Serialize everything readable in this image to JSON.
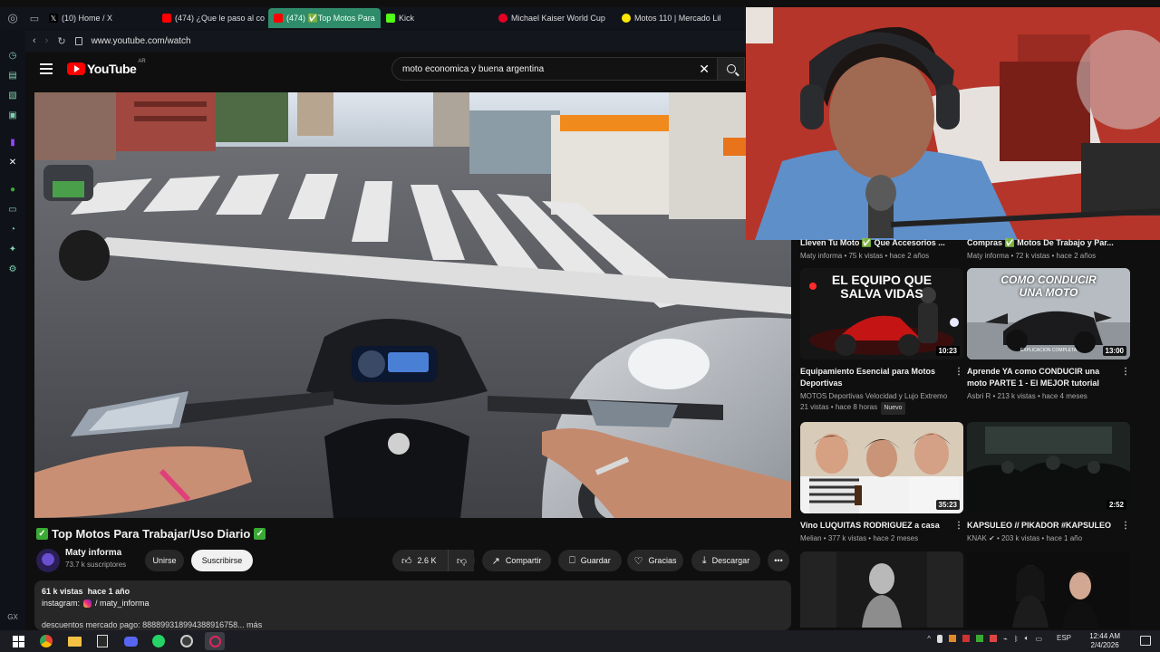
{
  "browser": {
    "logo": "GX",
    "tabs": [
      {
        "label": "(10) Home / X",
        "color": "#ffffff"
      },
      {
        "label": "(474) ¿Que le paso al co",
        "color": "#ff0000"
      },
      {
        "label": "(474) ✅Top Motos Para",
        "color": "#ff0000",
        "active": true
      },
      {
        "label": "Kick",
        "color": "#53fc18"
      },
      {
        "label": "Michael Kaiser World Cup",
        "color": "#e60023"
      },
      {
        "label": "Motos 110 | Mercado Libre",
        "color": "#ffe600"
      }
    ],
    "url": "www.youtube.com/watch",
    "accent": "#2f8c6a"
  },
  "youtube": {
    "logo_text": "YouTube",
    "country_code": "AR",
    "search_value": "moto economica y buena argentina"
  },
  "video": {
    "title": "Top Motos Para Trabajar/Uso Diario",
    "channel": "Maty informa",
    "subscribers": "73.7 k suscriptores",
    "join_label": "Unirse",
    "subscribe_label": "Suscribirse",
    "likes": "2.6 K",
    "share_label": "Compartir",
    "save_label": "Guardar",
    "thanks_label": "Gracias",
    "download_label": "Descargar",
    "views": "61 k vistas",
    "age": "hace 1 año",
    "instagram_prefix": "instagram:",
    "instagram_handle": "/ maty_informa",
    "desc_line3": "descuentos mercado pago: 888899318994388916758...  más"
  },
  "recommendations": {
    "partial_top": [
      {
        "title": "Lleven Tu Moto ✅ Que Accesorios ...",
        "meta": "Maty informa • 75 k vistas • hace 2 años"
      },
      {
        "title": "Compras ✅ Motos De Trabajo y Par...",
        "meta": "Maty informa • 72 k vistas • hace 2 años"
      }
    ],
    "cards": [
      {
        "title": "Equipamiento Esencial para Motos Deportivas",
        "channel": "MOTOS Deportivas Velocidad y Lujo Extremo",
        "meta": "21 vistas • hace 8 horas",
        "badge": "Nuevo",
        "duration": "10:23",
        "thumb_text": "EL EQUIPO QUE SALVA VIDAS"
      },
      {
        "title": "Aprende YA como CONDUCIR una moto PARTE 1 - El MEJOR tutorial",
        "channel": "Asbri R",
        "meta": "213 k vistas • hace 4 meses",
        "duration": "13:00",
        "thumb_text": "COMO CONDUCIR UNA MOTO",
        "thumb_sub": "EXPLICACION COMPLETA"
      },
      {
        "title": "Vino LUQUITAS RODRIGUEZ a casa",
        "channel": "Melian",
        "meta": "377 k vistas • hace 2 meses",
        "duration": "35:23"
      },
      {
        "title": "KAPSULEO // PIKADOR #KAPSULEO",
        "channel": "KNAK ✔",
        "meta": "203 k vistas • hace 1 año",
        "duration": "2:52"
      }
    ]
  },
  "taskbar": {
    "lang": "ESP",
    "time": "12:44 AM",
    "date": "2/4/2026"
  }
}
